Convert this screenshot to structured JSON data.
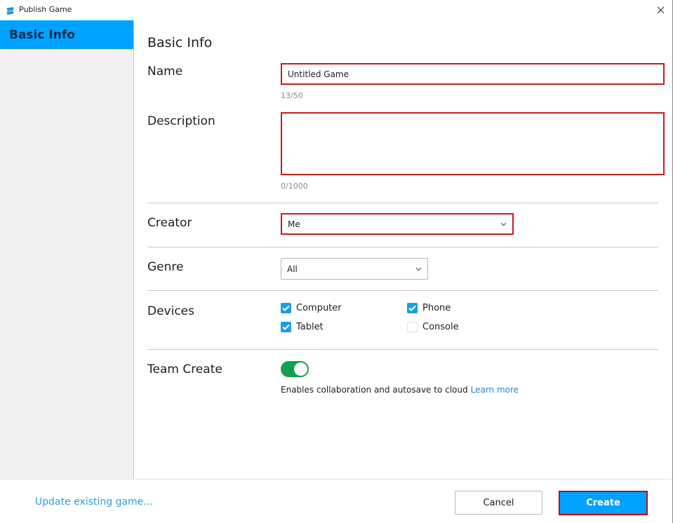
{
  "window": {
    "title": "Publish Game",
    "app_icon": "roblox-studio-icon",
    "close_icon": "close-icon"
  },
  "sidebar": {
    "items": [
      {
        "label": "Basic Info",
        "selected": true
      }
    ]
  },
  "form": {
    "section_title": "Basic Info",
    "name": {
      "label": "Name",
      "value": "Untitled Game",
      "counter": "13/50"
    },
    "description": {
      "label": "Description",
      "value": "",
      "counter": "0/1000"
    },
    "creator": {
      "label": "Creator",
      "selected": "Me"
    },
    "genre": {
      "label": "Genre",
      "selected": "All"
    },
    "devices": {
      "label": "Devices",
      "options": [
        {
          "label": "Computer",
          "checked": true
        },
        {
          "label": "Phone",
          "checked": true
        },
        {
          "label": "Tablet",
          "checked": true
        },
        {
          "label": "Console",
          "checked": false
        }
      ]
    },
    "team_create": {
      "label": "Team Create",
      "enabled": true,
      "help_text": "Enables collaboration and autosave to cloud",
      "learn_more": "Learn more"
    }
  },
  "footer": {
    "update_link": "Update existing game...",
    "cancel_label": "Cancel",
    "create_label": "Create"
  },
  "colors": {
    "accent": "#00a2ff",
    "highlight_border": "#cc1a1a",
    "toggle_on": "#10a14a",
    "checkbox_on": "#1a9ee6",
    "link": "#2a86c8"
  }
}
